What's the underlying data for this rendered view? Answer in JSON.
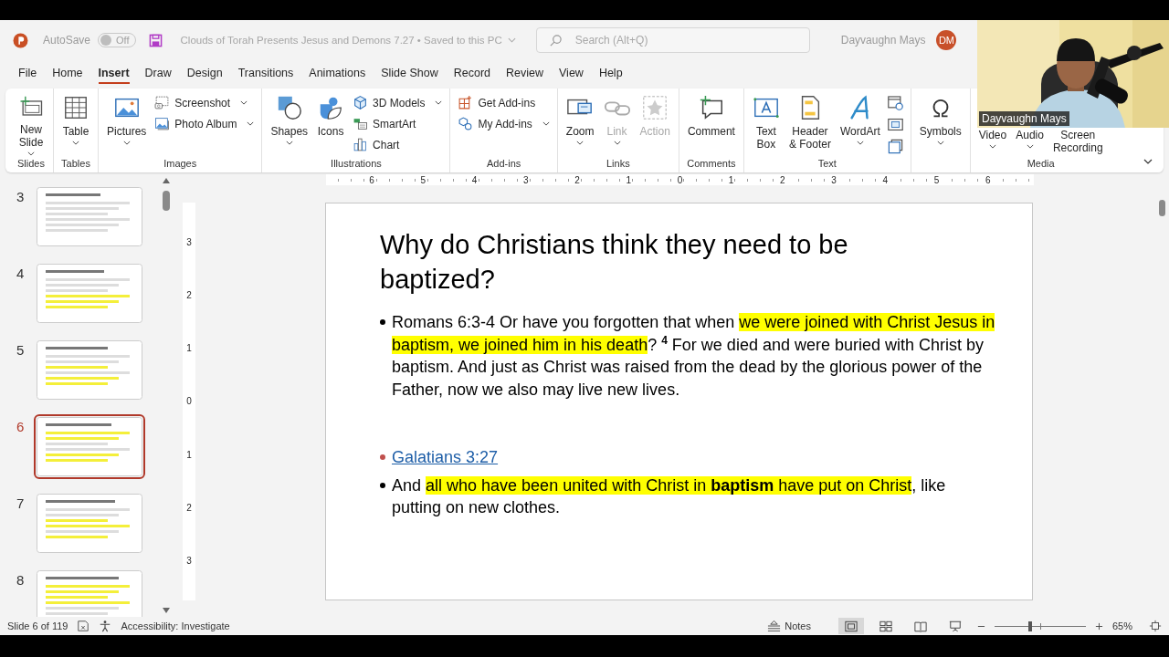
{
  "title_bar": {
    "autosave": {
      "label": "AutoSave",
      "on": false,
      "state_label": "Off"
    },
    "document_title": "Clouds of Torah Presents Jesus and Demons 7.27 • Saved to this PC",
    "search": {
      "placeholder": "Search (Alt+Q)"
    },
    "user": {
      "name": "Dayvaughn Mays",
      "initials": "DM"
    }
  },
  "menu_tabs": [
    {
      "label": "File",
      "selected": false
    },
    {
      "label": "Home",
      "selected": false
    },
    {
      "label": "Insert",
      "selected": true
    },
    {
      "label": "Draw",
      "selected": false
    },
    {
      "label": "Design",
      "selected": false
    },
    {
      "label": "Transitions",
      "selected": false
    },
    {
      "label": "Animations",
      "selected": false
    },
    {
      "label": "Slide Show",
      "selected": false
    },
    {
      "label": "Record",
      "selected": false
    },
    {
      "label": "Review",
      "selected": false
    },
    {
      "label": "View",
      "selected": false
    },
    {
      "label": "Help",
      "selected": false
    }
  ],
  "ribbon": {
    "groups": [
      {
        "label": "Slides",
        "items": [
          {
            "kind": "large",
            "label": "New\nSlide",
            "dropdown": true,
            "disabled": false
          }
        ]
      },
      {
        "label": "Tables",
        "items": [
          {
            "kind": "large",
            "label": "Table",
            "dropdown": true,
            "disabled": false
          }
        ]
      },
      {
        "label": "Images",
        "items": [
          {
            "kind": "large",
            "label": "Pictures",
            "dropdown": true,
            "disabled": false
          },
          {
            "kind": "small",
            "label": "Screenshot",
            "dropdown": true,
            "disabled": false
          },
          {
            "kind": "small",
            "label": "Photo Album",
            "dropdown": true,
            "disabled": false
          }
        ]
      },
      {
        "label": "Illustrations",
        "items": [
          {
            "kind": "large",
            "label": "Shapes",
            "dropdown": true,
            "disabled": false
          },
          {
            "kind": "large",
            "label": "Icons",
            "dropdown": false,
            "disabled": false
          },
          {
            "kind": "small",
            "label": "3D Models",
            "dropdown": true,
            "disabled": false
          },
          {
            "kind": "small",
            "label": "SmartArt",
            "dropdown": false,
            "disabled": false
          },
          {
            "kind": "small",
            "label": "Chart",
            "dropdown": false,
            "disabled": false
          }
        ]
      },
      {
        "label": "Add-ins",
        "items": [
          {
            "kind": "small",
            "label": "Get Add-ins",
            "dropdown": false,
            "disabled": false
          },
          {
            "kind": "small",
            "label": "My Add-ins",
            "dropdown": true,
            "disabled": false
          }
        ]
      },
      {
        "label": "Links",
        "items": [
          {
            "kind": "large",
            "label": "Zoom",
            "dropdown": true,
            "disabled": false
          },
          {
            "kind": "large",
            "label": "Link",
            "dropdown": true,
            "disabled": true
          },
          {
            "kind": "large",
            "label": "Action",
            "dropdown": false,
            "disabled": true
          }
        ]
      },
      {
        "label": "Comments",
        "items": [
          {
            "kind": "large",
            "label": "Comment",
            "dropdown": false,
            "disabled": false
          }
        ]
      },
      {
        "label": "Text",
        "items": [
          {
            "kind": "large",
            "label": "Text\nBox",
            "dropdown": false,
            "disabled": false
          },
          {
            "kind": "large",
            "label": "Header\n& Footer",
            "dropdown": false,
            "disabled": false
          },
          {
            "kind": "large",
            "label": "WordArt",
            "dropdown": true,
            "disabled": false
          },
          {
            "kind": "icon",
            "dropdown": false,
            "disabled": false
          },
          {
            "kind": "icon",
            "dropdown": false,
            "disabled": false
          },
          {
            "kind": "icon",
            "dropdown": false,
            "disabled": false
          }
        ]
      },
      {
        "items": [
          {
            "kind": "large",
            "label": "Symbols",
            "dropdown": true,
            "disabled": false
          }
        ]
      },
      {
        "label": "Media",
        "items": [
          {
            "kind": "large",
            "label": "Video",
            "dropdown": true,
            "disabled": false
          },
          {
            "kind": "large",
            "label": "Audio",
            "dropdown": true,
            "disabled": false
          },
          {
            "kind": "large",
            "label": "Screen\nRecording",
            "dropdown": false,
            "disabled": false
          }
        ]
      }
    ]
  },
  "webcam": {
    "kind": "picture",
    "name_label": "Dayvaughn Mays"
  },
  "slides_pane": [
    {
      "number": "3",
      "selected": false
    },
    {
      "number": "4",
      "selected": false
    },
    {
      "number": "5",
      "selected": false
    },
    {
      "number": "6",
      "selected": true
    },
    {
      "number": "7",
      "selected": false
    },
    {
      "number": "8",
      "selected": false
    }
  ],
  "rulers": {
    "horizontal": [
      "6",
      "5",
      "4",
      "3",
      "2",
      "1",
      "0",
      "1",
      "2",
      "3",
      "4",
      "5",
      "6"
    ],
    "vertical": [
      "3",
      "2",
      "1",
      "0",
      "1",
      "2",
      "3"
    ]
  },
  "slide": {
    "title": "Why do Christians think they need to be baptized?",
    "bullets": [
      {
        "kind": "text",
        "segments": [
          {
            "text": "Romans 6:3-4 Or have you forgotten that when ",
            "highlight": false
          },
          {
            "text": "we were joined with Christ Jesus in baptism, we joined him in his death",
            "highlight": true
          },
          {
            "text": "? $^{4}$ For we died and were buried with Christ by baptism. And just as Christ was raised from the dead by the glorious power of the Father, now we also may live new lives.",
            "highlight": false
          }
        ]
      },
      {
        "kind": "link",
        "segments": [
          {
            "text": "Galatians 3:27",
            "highlight": false
          }
        ]
      },
      {
        "kind": "text",
        "segments": [
          {
            "text": "And ",
            "highlight": false
          },
          {
            "text": "all who have been united with Christ in **baptism** have put on Christ",
            "highlight": true
          },
          {
            "text": ", like putting on new clothes.",
            "highlight": false
          }
        ]
      }
    ]
  },
  "status_bar": {
    "slide_position": "Slide 6 of 119",
    "accessibility": "Accessibility: Investigate",
    "notes": "Notes",
    "views": [
      {
        "selected": true
      },
      {
        "selected": false
      },
      {
        "selected": false
      },
      {
        "selected": false
      }
    ],
    "zoom": {
      "level": 0.39,
      "reading": "65%"
    }
  }
}
